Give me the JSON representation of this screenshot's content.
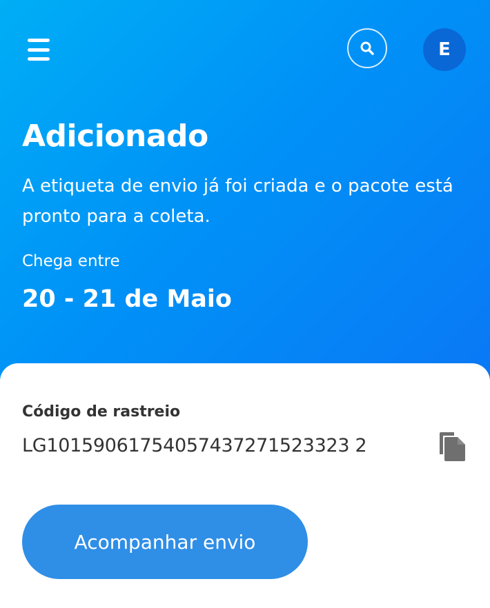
{
  "header": {
    "menu_icon": "hamburger-menu-icon",
    "search_icon": "search-icon",
    "avatar_initial": "E"
  },
  "shipment": {
    "status": "Adicionado",
    "description": "A etiqueta de envio já foi criada e o pacote está pronto para a coleta.",
    "eta_label": "Chega entre",
    "eta_date": "20 - 21 de Maio"
  },
  "tracking": {
    "label": "Código de rastreio",
    "code": "LG10159061754057437271523323 2",
    "copy_icon": "copy-icon",
    "button_label": "Acompanhar envio"
  },
  "colors": {
    "hero_gradient_start": "#00aef5",
    "hero_gradient_end": "#0a78f5",
    "avatar_bg": "#0a67d6",
    "button_bg": "#2f8ee6",
    "text_dark": "#333333"
  }
}
